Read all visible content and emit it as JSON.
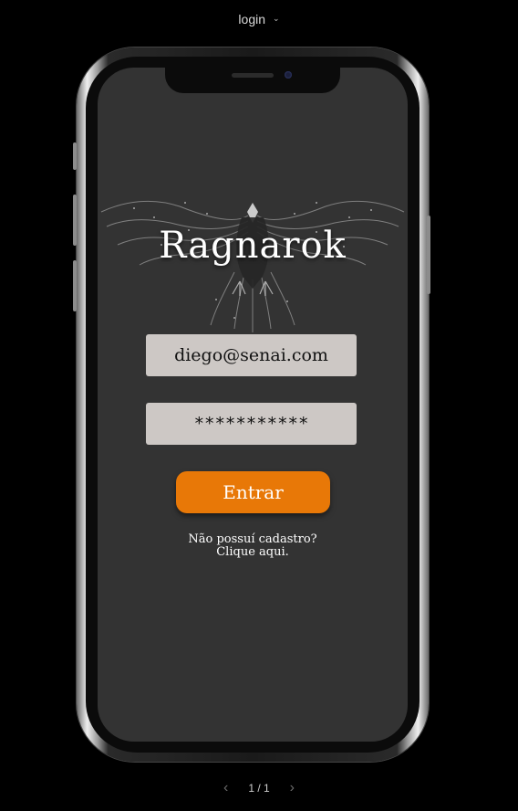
{
  "toolbar": {
    "frame_name": "login",
    "chevron": "⌄"
  },
  "app": {
    "title": "Ragnarok",
    "logo_icon": "eagle-icon",
    "email_value": "diego@senai.com",
    "password_value": "***********",
    "login_button": "Entrar",
    "signup_line1": "Não possuí cadastro?",
    "signup_line2": "Clique aqui."
  },
  "pager": {
    "prev": "‹",
    "label": "1 / 1",
    "next": "›"
  },
  "colors": {
    "background": "#000000",
    "screen": "#333333",
    "field": "#cdc8c5",
    "button": "#e87807"
  }
}
